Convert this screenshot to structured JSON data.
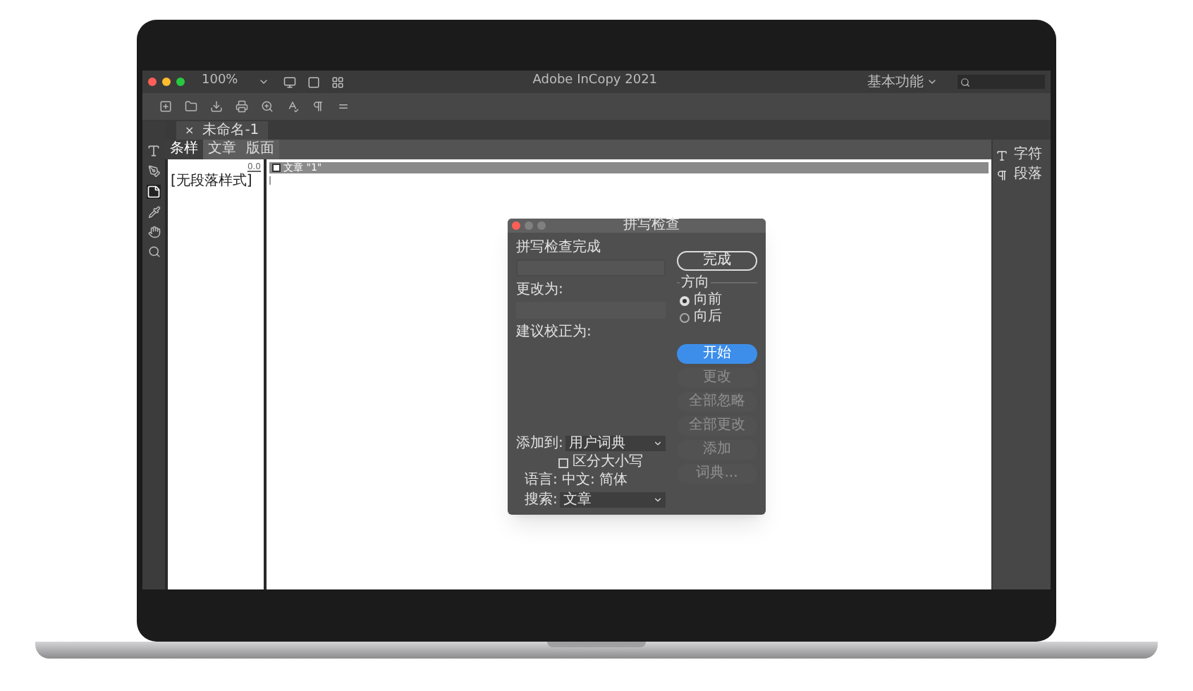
{
  "window": {
    "title": "Adobe InCopy 2021",
    "zoom": "100%"
  },
  "workspace": {
    "label": "基本功能"
  },
  "document_tab": {
    "close": "×",
    "title": "未命名-1"
  },
  "panel_tabs": [
    {
      "label": "条样",
      "selected": true
    },
    {
      "label": "文章",
      "selected": false
    },
    {
      "label": "版面",
      "selected": false
    }
  ],
  "styles_column": {
    "value": "0.0",
    "style": "[无段落样式]"
  },
  "story": {
    "title": "文章 \"1\""
  },
  "right_panel": [
    {
      "kind": "character",
      "label": "字符"
    },
    {
      "kind": "paragraph",
      "label": "段落"
    }
  ],
  "dialog": {
    "title": "拼写检查",
    "status": "拼写检查完成",
    "change_to": "更改为:",
    "suggestions": "建议校正为:",
    "direction": {
      "label": "方向",
      "options": [
        {
          "label": "向前",
          "selected": true
        },
        {
          "label": "向后",
          "selected": false
        }
      ]
    },
    "top_button": {
      "label": "完成",
      "kind": "outline",
      "disabled": false
    },
    "buttons": [
      {
        "label": "开始",
        "kind": "primary",
        "disabled": false
      },
      {
        "label": "更改",
        "kind": "plain",
        "disabled": true
      },
      {
        "label": "全部忽略",
        "kind": "plain",
        "disabled": true
      },
      {
        "label": "全部更改",
        "kind": "plain",
        "disabled": true
      },
      {
        "label": "添加",
        "kind": "plain",
        "disabled": true
      },
      {
        "label": "词典...",
        "kind": "plain",
        "disabled": true
      }
    ],
    "add_to": {
      "label": "添加到:",
      "value": "用户词典"
    },
    "case_sensitive": {
      "label": "区分大小写",
      "checked": false
    },
    "language": "语言: 中文: 简体",
    "search": {
      "label": "搜索:",
      "value": "文章"
    }
  }
}
